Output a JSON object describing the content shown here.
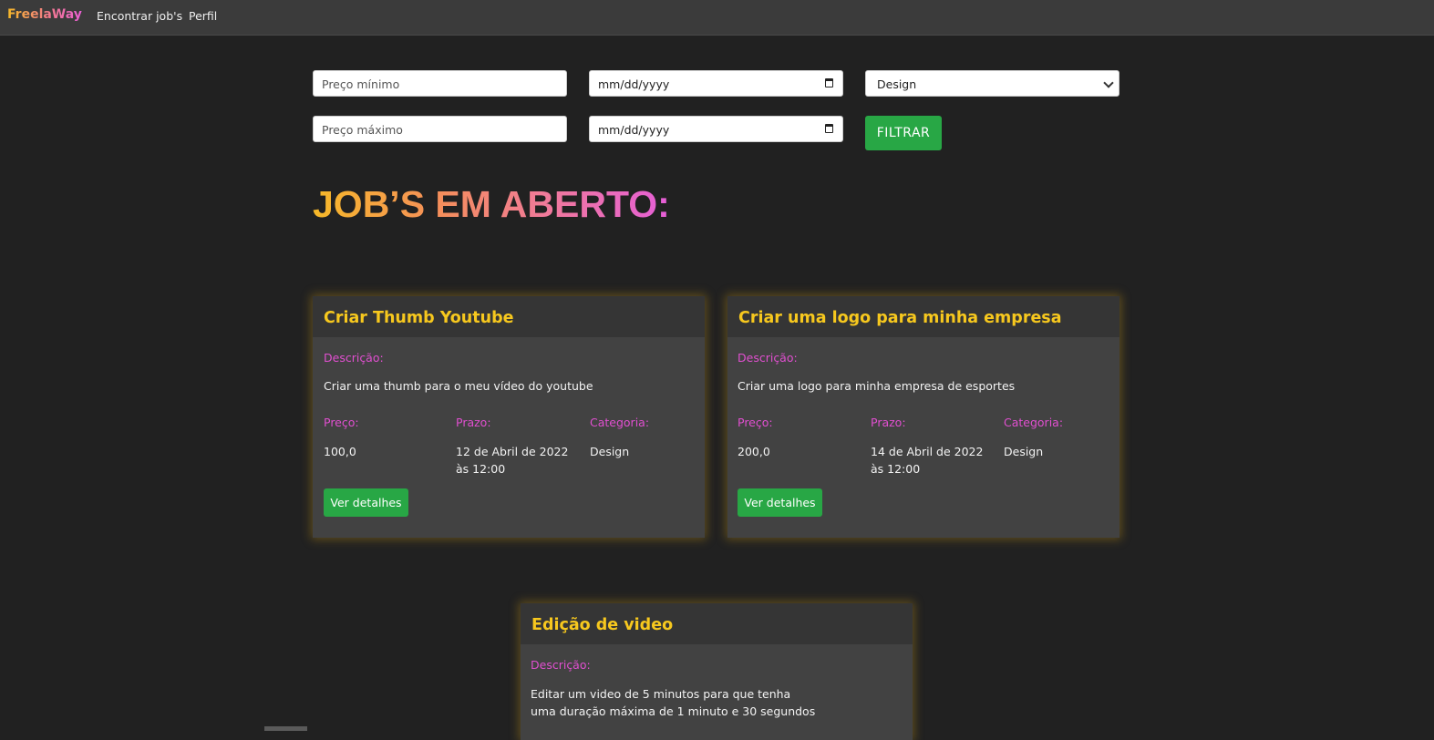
{
  "nav": {
    "brand": "FreelaWay",
    "links": [
      "Encontrar job's",
      "Perfil"
    ]
  },
  "filters": {
    "min_price_placeholder": "Preço mínimo",
    "max_price_placeholder": "Preço máximo",
    "date_from": "mm/dd/yyyy",
    "date_to": "mm/dd/yyyy",
    "category_selected": "Design",
    "submit_label": "FILTRAR"
  },
  "heading": "JOB’S EM ABERTO:",
  "labels": {
    "description": "Descrição:",
    "price": "Preço:",
    "deadline": "Prazo:",
    "category": "Categoria:",
    "details_button": "Ver detalhes"
  },
  "jobs": [
    {
      "title": "Criar Thumb Youtube",
      "description": "Criar uma thumb para o meu vídeo do youtube",
      "price": "100,0",
      "deadline_line1": "12 de Abril de 2022",
      "deadline_line2": "às 12:00",
      "category": "Design"
    },
    {
      "title": "Criar uma logo para minha empresa",
      "description": "Criar uma logo para minha empresa de esportes",
      "price": "200,0",
      "deadline_line1": "14 de Abril de 2022",
      "deadline_line2": "às 12:00",
      "category": "Design"
    },
    {
      "title": "Edição de video",
      "description_line1": "Editar um video de 5 minutos para que tenha",
      "description_line2": "uma duração máxima de 1 minuto e 30 segundos"
    }
  ],
  "colors": {
    "accent_yellow": "#f7c81e",
    "accent_pink": "#e14fd0",
    "button_green": "#28a745",
    "background": "#212121"
  }
}
